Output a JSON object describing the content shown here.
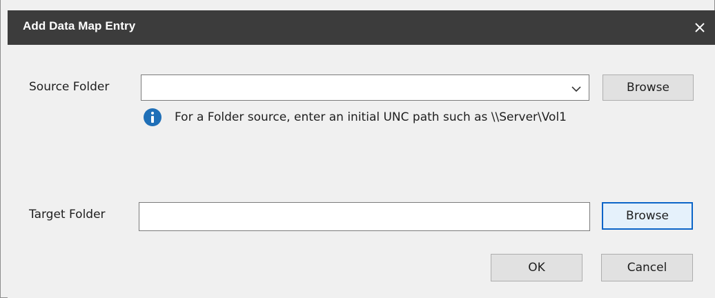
{
  "window": {
    "title": "Add Data Map Entry",
    "close_glyph": "✕"
  },
  "source": {
    "label": "Source Folder",
    "value": "",
    "browse_label": "Browse",
    "hint": "For a Folder source, enter an initial UNC path such as \\\\Server\\Vol1"
  },
  "target": {
    "label": "Target Folder",
    "value": "",
    "browse_label": "Browse"
  },
  "footer": {
    "ok_label": "OK",
    "cancel_label": "Cancel"
  },
  "colors": {
    "titlebar": "#3c3c3c",
    "info_icon": "#1f6fb7",
    "focus_border": "#0a64c8"
  },
  "icons": {
    "close": "close-icon",
    "dropdown": "chevron-down-icon",
    "info": "info-icon"
  }
}
